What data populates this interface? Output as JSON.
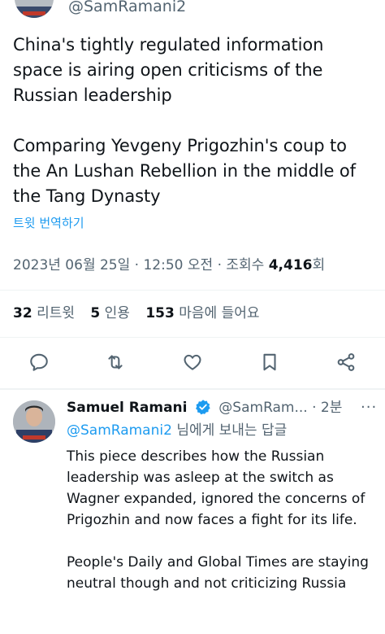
{
  "top_tweet": {
    "handle": "@SamRamani2",
    "paragraphs": [
      "China's tightly regulated information space is airing open criticisms of the Russian leadership",
      "Comparing Yevgeny Prigozhin's coup to the An Lushan Rebellion in the middle of the Tang Dynasty"
    ],
    "translate_label": "트윗 번역하기",
    "timestamp": "2023년 06월 25일 · 12:50 오전",
    "views_label": "· 조회수",
    "views_count": "4,416",
    "views_suffix": "회"
  },
  "stats": {
    "retweets_count": "32",
    "retweets_label": "리트윗",
    "quotes_count": "5",
    "quotes_label": "인용",
    "likes_count": "153",
    "likes_label": "마음에 들어요"
  },
  "actions": {
    "icons": [
      "reply-icon",
      "retweet-icon",
      "like-icon",
      "bookmark-icon",
      "share-icon"
    ],
    "icon_color": "#536471"
  },
  "reply": {
    "name": "Samuel Ramani",
    "handle": "@SamRam...",
    "time": "· 2분",
    "more": "···",
    "replying_mention": "@SamRamani2",
    "replying_suffix": " 님에게 보내는 답글",
    "paragraphs": [
      "This piece describes how the Russian leadership was asleep at the switch as Wagner expanded, ignored the concerns of Prigozhin and now faces a fight for its life.",
      "People's Daily and Global Times are staying neutral though and not criticizing Russia"
    ]
  },
  "colors": {
    "accent": "#1d9bf0",
    "text": "#0f1419",
    "muted": "#536471",
    "divider": "#eff3f4"
  }
}
